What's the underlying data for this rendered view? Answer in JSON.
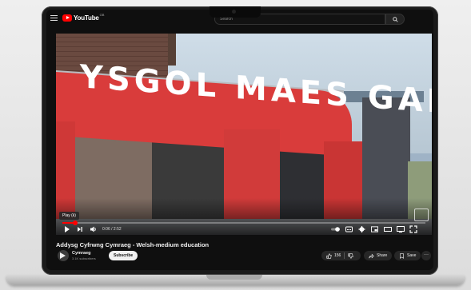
{
  "header": {
    "logo_text": "YouTube",
    "logo_superscript": "GB",
    "search_placeholder": "Search"
  },
  "video": {
    "signage_text": "YSGOL MAES GARMON",
    "tooltip": "Play (k)",
    "time_current": "0:06",
    "time_total": "2:52",
    "progress_fraction": 0.035
  },
  "info": {
    "title": "Addysg Cyfrwng Cymraeg - Welsh-medium education",
    "channel_name": "Cymraeg",
    "subscribers": "3.1K subscribers",
    "subscribe_label": "Subscribe",
    "like_count": "156",
    "share_label": "Share",
    "save_label": "Save"
  },
  "colors": {
    "accent": "#ff0000",
    "background": "#0f0f0f"
  }
}
